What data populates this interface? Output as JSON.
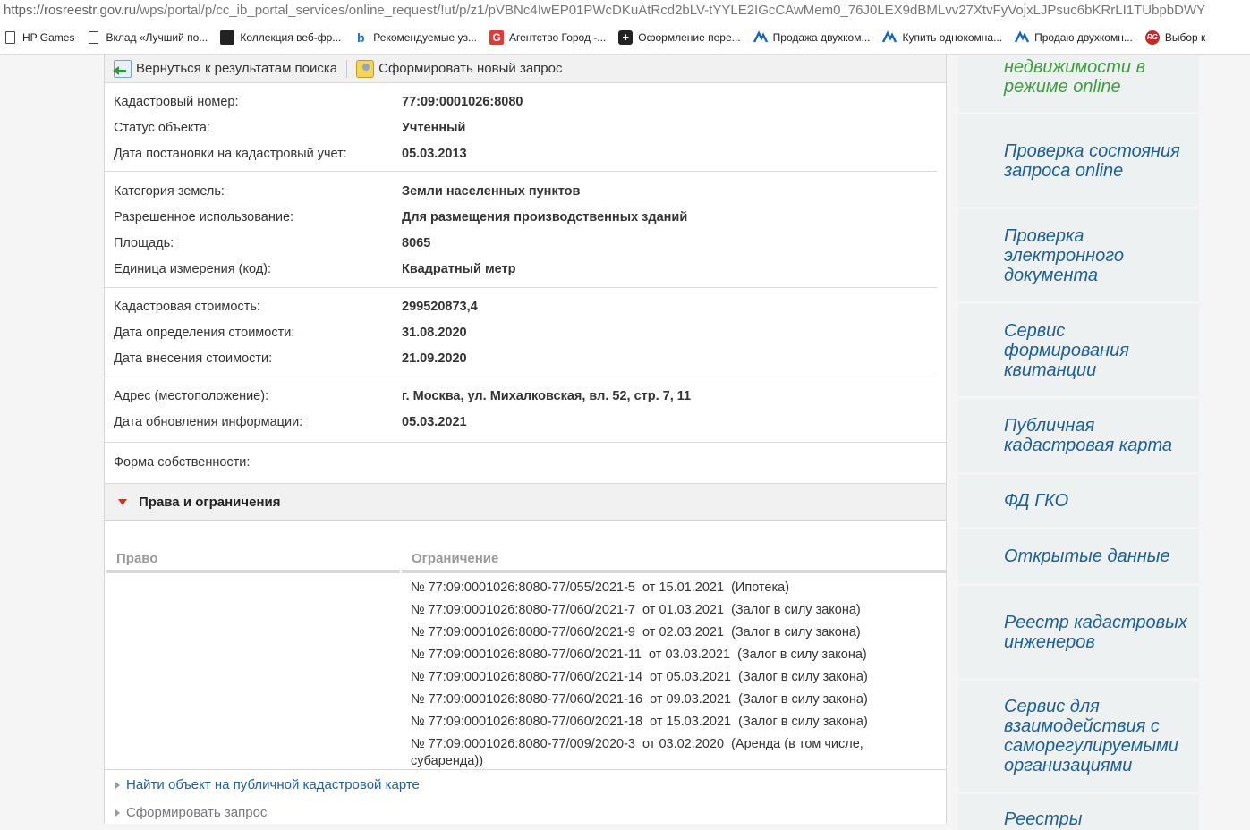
{
  "browser": {
    "url_host": "https://rosreestr.gov.ru",
    "url_path": "/wps/portal/p/cc_ib_portal_services/online_request/!ut/p/z1/pVBNc4IwEP01PWcDKuAtRcd2bLV-tYYLE2IGcCAwMem0_76J0LEX9dBMLvv27XtvFyVojxLJPsuc6bKRrLI1TUbpbDWY",
    "bookmarks": [
      {
        "label": "HP Games",
        "icon": "page-icon"
      },
      {
        "label": "Вклад «Лучший по...",
        "icon": "page-icon"
      },
      {
        "label": "Коллекция веб-фр...",
        "icon": "collection-icon"
      },
      {
        "label": "Рекомендуемые уз...",
        "icon": "bing-icon"
      },
      {
        "label": "Агентство Город -...",
        "icon": "g-icon"
      },
      {
        "label": "Оформление пере...",
        "icon": "plus-icon"
      },
      {
        "label": "Продажа двухком...",
        "icon": "m-icon"
      },
      {
        "label": "Купить однокомна...",
        "icon": "m-icon"
      },
      {
        "label": "Продаю двухкомн...",
        "icon": "m-icon"
      },
      {
        "label": "Выбор к",
        "icon": "rg-icon"
      }
    ]
  },
  "toolbar": {
    "back_label": "Вернуться к результатам поиска",
    "new_request_label": "Сформировать новый запрос"
  },
  "info": {
    "cadastral_number": {
      "label": "Кадастровый номер:",
      "value": "77:09:0001026:8080"
    },
    "status": {
      "label": "Статус объекта:",
      "value": "Учтенный"
    },
    "registration_date": {
      "label": "Дата постановки на кадастровый учет:",
      "value": "05.03.2013"
    },
    "land_category": {
      "label": "Категория земель:",
      "value": "Земли населенных пунктов"
    },
    "permitted_use": {
      "label": "Разрешенное использование:",
      "value": "Для размещения производственных зданий"
    },
    "area": {
      "label": "Площадь:",
      "value": "8065"
    },
    "unit": {
      "label": "Единица измерения (код):",
      "value": "Квадратный метр"
    },
    "cadastral_value": {
      "label": "Кадастровая стоимость:",
      "value": "299520873,4"
    },
    "value_date": {
      "label": "Дата определения стоимости:",
      "value": "31.08.2020"
    },
    "value_entry_date": {
      "label": "Дата внесения стоимости:",
      "value": "21.09.2020"
    },
    "address": {
      "label": "Адрес (местоположение):",
      "value": "г. Москва, ул. Михалковская, вл. 52, стр. 7, 11"
    },
    "update_date": {
      "label": "Дата обновления информации:",
      "value": "05.03.2021"
    },
    "ownership": {
      "label": "Форма собственности:",
      "value": ""
    }
  },
  "rights": {
    "title": "Права и ограничения",
    "col_right": "Право",
    "col_restriction": "Ограничение",
    "restrictions": [
      "№ 77:09:0001026:8080-77/055/2021-5  от 15.01.2021  (Ипотека)",
      "№ 77:09:0001026:8080-77/060/2021-7  от 01.03.2021  (Залог в силу закона)",
      "№ 77:09:0001026:8080-77/060/2021-9  от 02.03.2021  (Залог в силу закона)",
      "№ 77:09:0001026:8080-77/060/2021-11  от 03.03.2021  (Залог в силу закона)",
      "№ 77:09:0001026:8080-77/060/2021-14  от 05.03.2021  (Залог в силу закона)",
      "№ 77:09:0001026:8080-77/060/2021-16  от 09.03.2021  (Залог в силу закона)",
      "№ 77:09:0001026:8080-77/060/2021-18  от 15.03.2021  (Залог в силу закона)",
      "№ 77:09:0001026:8080-77/009/2020-3  от 03.02.2020  (Аренда (в том числе, субаренда))"
    ]
  },
  "links": {
    "find_on_map": "Найти объект на публичной кадастровой карте",
    "form_request": "Сформировать запрос"
  },
  "sidebar": {
    "items": [
      {
        "label": "недвижимости в режиме online"
      },
      {
        "label": "Проверка состояния запроса online"
      },
      {
        "label": "Проверка электронного документа"
      },
      {
        "label": "Сервис формирования квитанции"
      },
      {
        "label": "Публичная кадастровая карта"
      },
      {
        "label": "ФД ГКО"
      },
      {
        "label": "Открытые данные"
      },
      {
        "label": "Реестр кадастровых инженеров"
      },
      {
        "label": "Сервис для взаимодействия с саморегулируемыми организациями"
      },
      {
        "label": "Реестры"
      }
    ]
  },
  "colors": {
    "link": "#1e5fa8",
    "sidebar_link": "#1a5f9b",
    "sidebar_green": "#3e9e3e",
    "accent_triangle": "#c0392b"
  }
}
